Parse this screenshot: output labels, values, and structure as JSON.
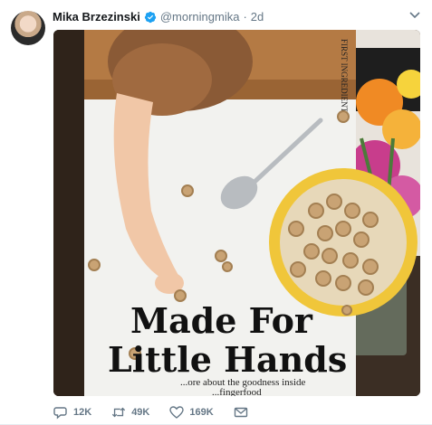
{
  "tweet": {
    "author_name": "Mika Brzezinski",
    "handle": "@morningmika",
    "separator": "·",
    "time": "2d"
  },
  "media": {
    "box_corner_text": "FIRST INGREDIENT",
    "headline_line1": "Made For",
    "headline_line2": "Little Hands",
    "sub_line1": "...ore about the goodness inside",
    "sub_line2": "...fingerfood"
  },
  "actions": {
    "replies": "12K",
    "retweets": "49K",
    "likes": "169K"
  },
  "colors": {
    "name": "#14171a",
    "secondary": "#657786",
    "verified": "#1da1f2"
  }
}
